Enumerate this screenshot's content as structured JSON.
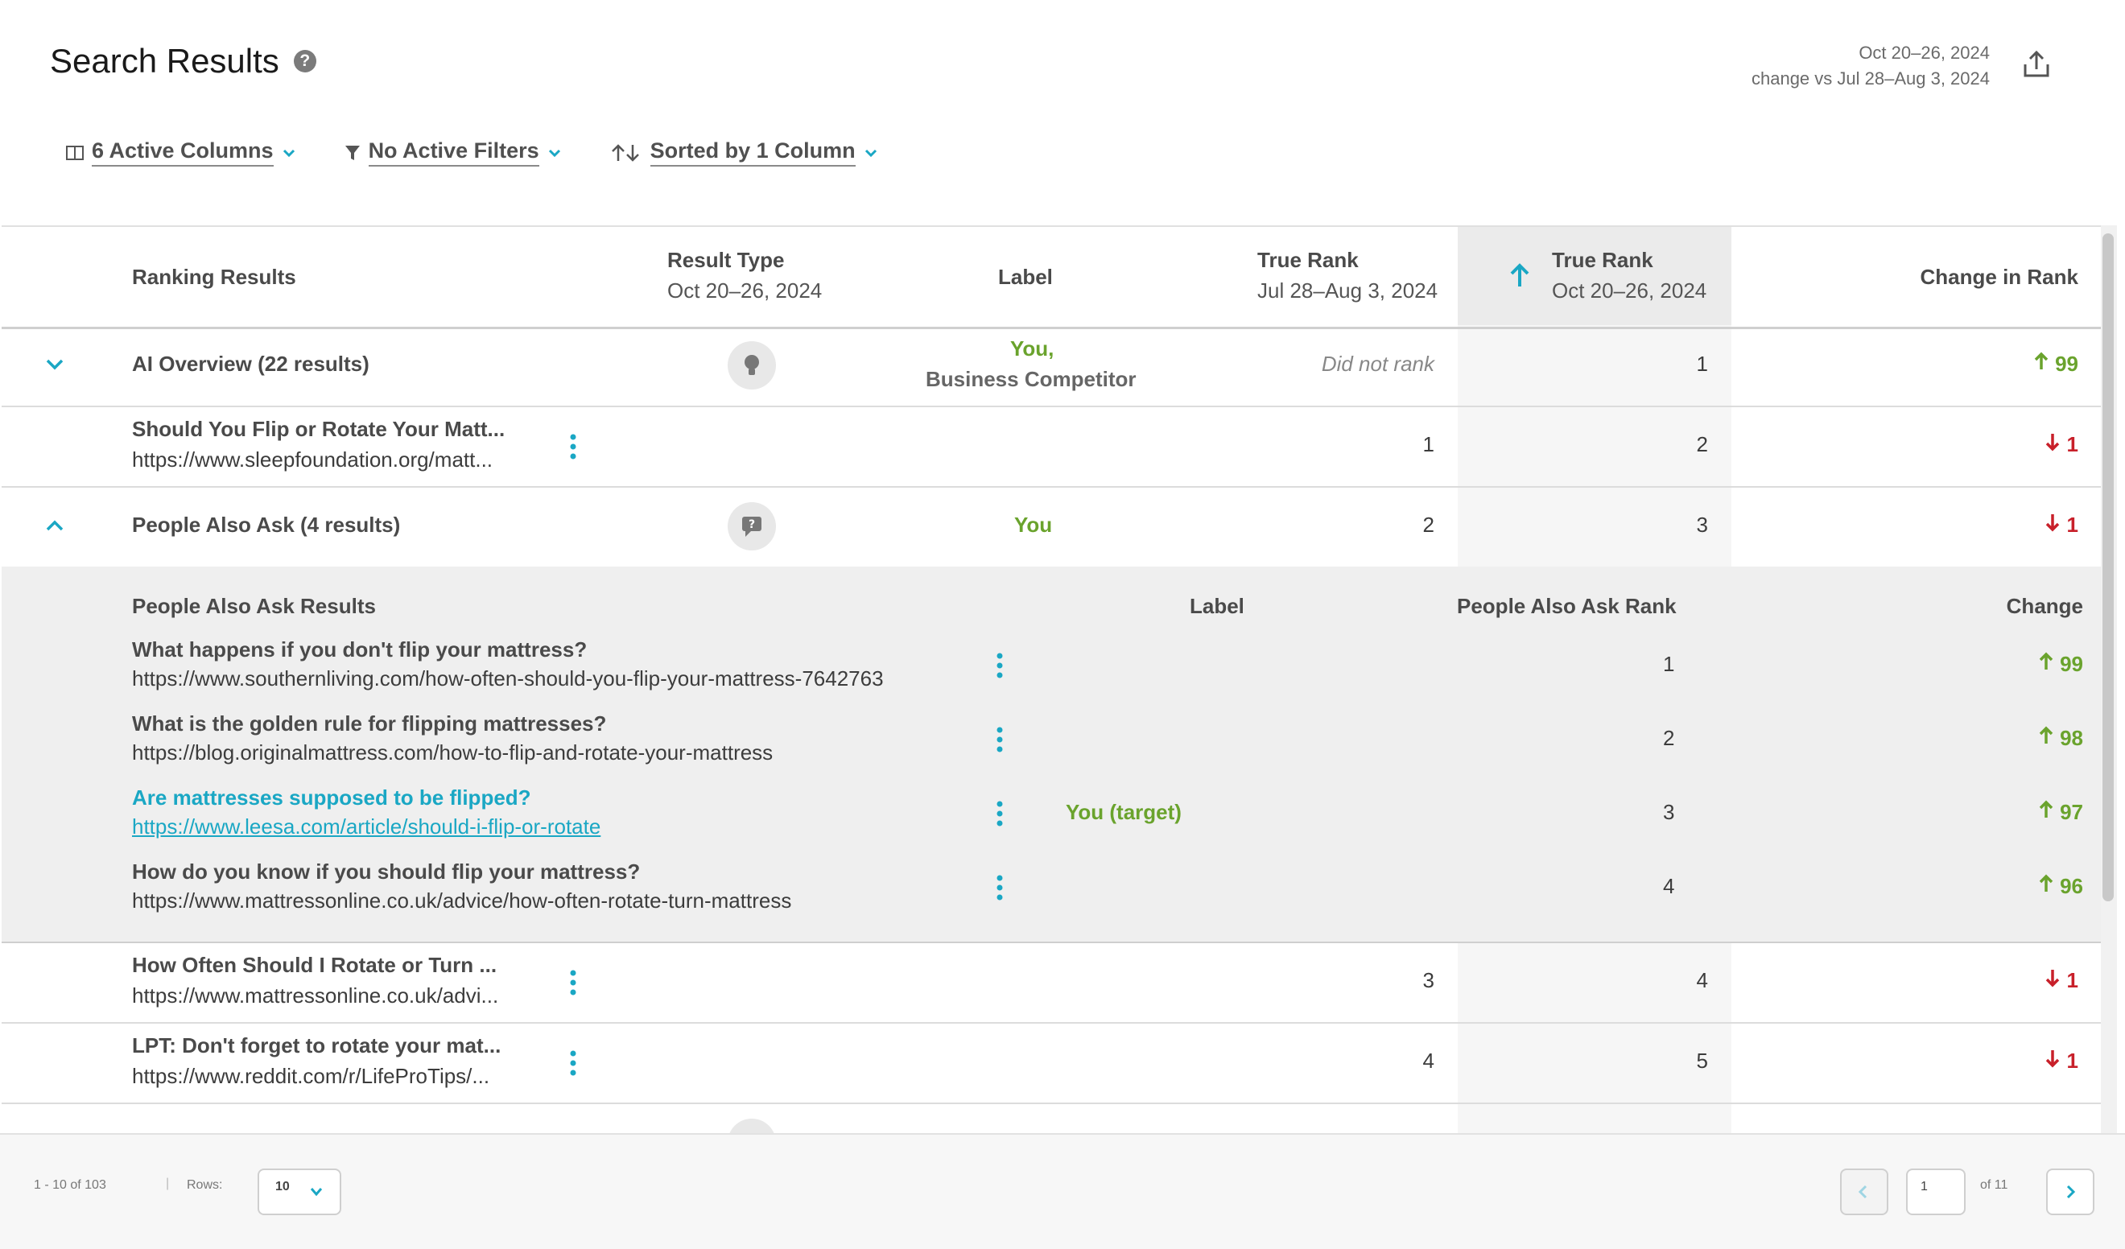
{
  "header": {
    "title": "Search Results",
    "date_range": "Oct 20–26, 2024",
    "comparison": "change vs Jul 28–Aug 3, 2024"
  },
  "toolbar": {
    "columns_label": "6 Active Columns",
    "filters_label": "No Active Filters",
    "sort_label": "Sorted by 1 Column"
  },
  "table": {
    "headers": {
      "ranking_results": "Ranking Results",
      "result_type": "Result Type",
      "result_type_sub": "Oct 20–26, 2024",
      "label": "Label",
      "true_rank_prev": "True Rank",
      "true_rank_prev_sub": "Jul 28–Aug 3, 2024",
      "true_rank_cur": "True Rank",
      "true_rank_cur_sub": "Oct 20–26, 2024",
      "change": "Change in Rank"
    },
    "rows": [
      {
        "title": "AI Overview (22 results)",
        "label_line1": "You,",
        "label_line2": "Business Competitor",
        "prev": "Did not rank",
        "cur": "1",
        "change": "99"
      },
      {
        "title": "Should You Flip or Rotate Your Matt...",
        "url": "https://www.sleepfoundation.org/matt...",
        "prev": "1",
        "cur": "2",
        "change": "1"
      },
      {
        "title": "People Also Ask (4 results)",
        "label": "You",
        "prev": "2",
        "cur": "3",
        "change": "1"
      },
      {
        "title": "How Often Should I Rotate or Turn ...",
        "url": "https://www.mattressonline.co.uk/advi...",
        "prev": "3",
        "cur": "4",
        "change": "1"
      },
      {
        "title": "LPT: Don't forget to rotate your mat...",
        "url": "https://www.reddit.com/r/LifeProTips/...",
        "prev": "4",
        "cur": "5",
        "change": "1"
      }
    ],
    "paa": {
      "headers": {
        "results": "People Also Ask Results",
        "label": "Label",
        "rank": "People Also Ask Rank",
        "change": "Change"
      },
      "items": [
        {
          "question": "What happens if you don't flip your mattress?",
          "url": "https://www.southernliving.com/how-often-should-you-flip-your-mattress-7642763",
          "label": "",
          "rank": "1",
          "change": "99"
        },
        {
          "question": "What is the golden rule for flipping mattresses?",
          "url": "https://blog.originalmattress.com/how-to-flip-and-rotate-your-mattress",
          "label": "",
          "rank": "2",
          "change": "98"
        },
        {
          "question": "Are mattresses supposed to be flipped?",
          "url": "https://www.leesa.com/article/should-i-flip-or-rotate",
          "label": "You (target)",
          "rank": "3",
          "change": "97"
        },
        {
          "question": "How do you know if you should flip your mattress?",
          "url": "https://www.mattressonline.co.uk/advice/how-often-rotate-turn-mattress",
          "label": "",
          "rank": "4",
          "change": "96"
        }
      ]
    }
  },
  "footer": {
    "range": "1 - 10 of 103",
    "rows_label": "Rows:",
    "rows_value": "10",
    "page": "1",
    "of_pages": "of 11"
  },
  "colors": {
    "accent": "#1aa7c4",
    "up": "#6aa32d",
    "down": "#c8202a"
  }
}
